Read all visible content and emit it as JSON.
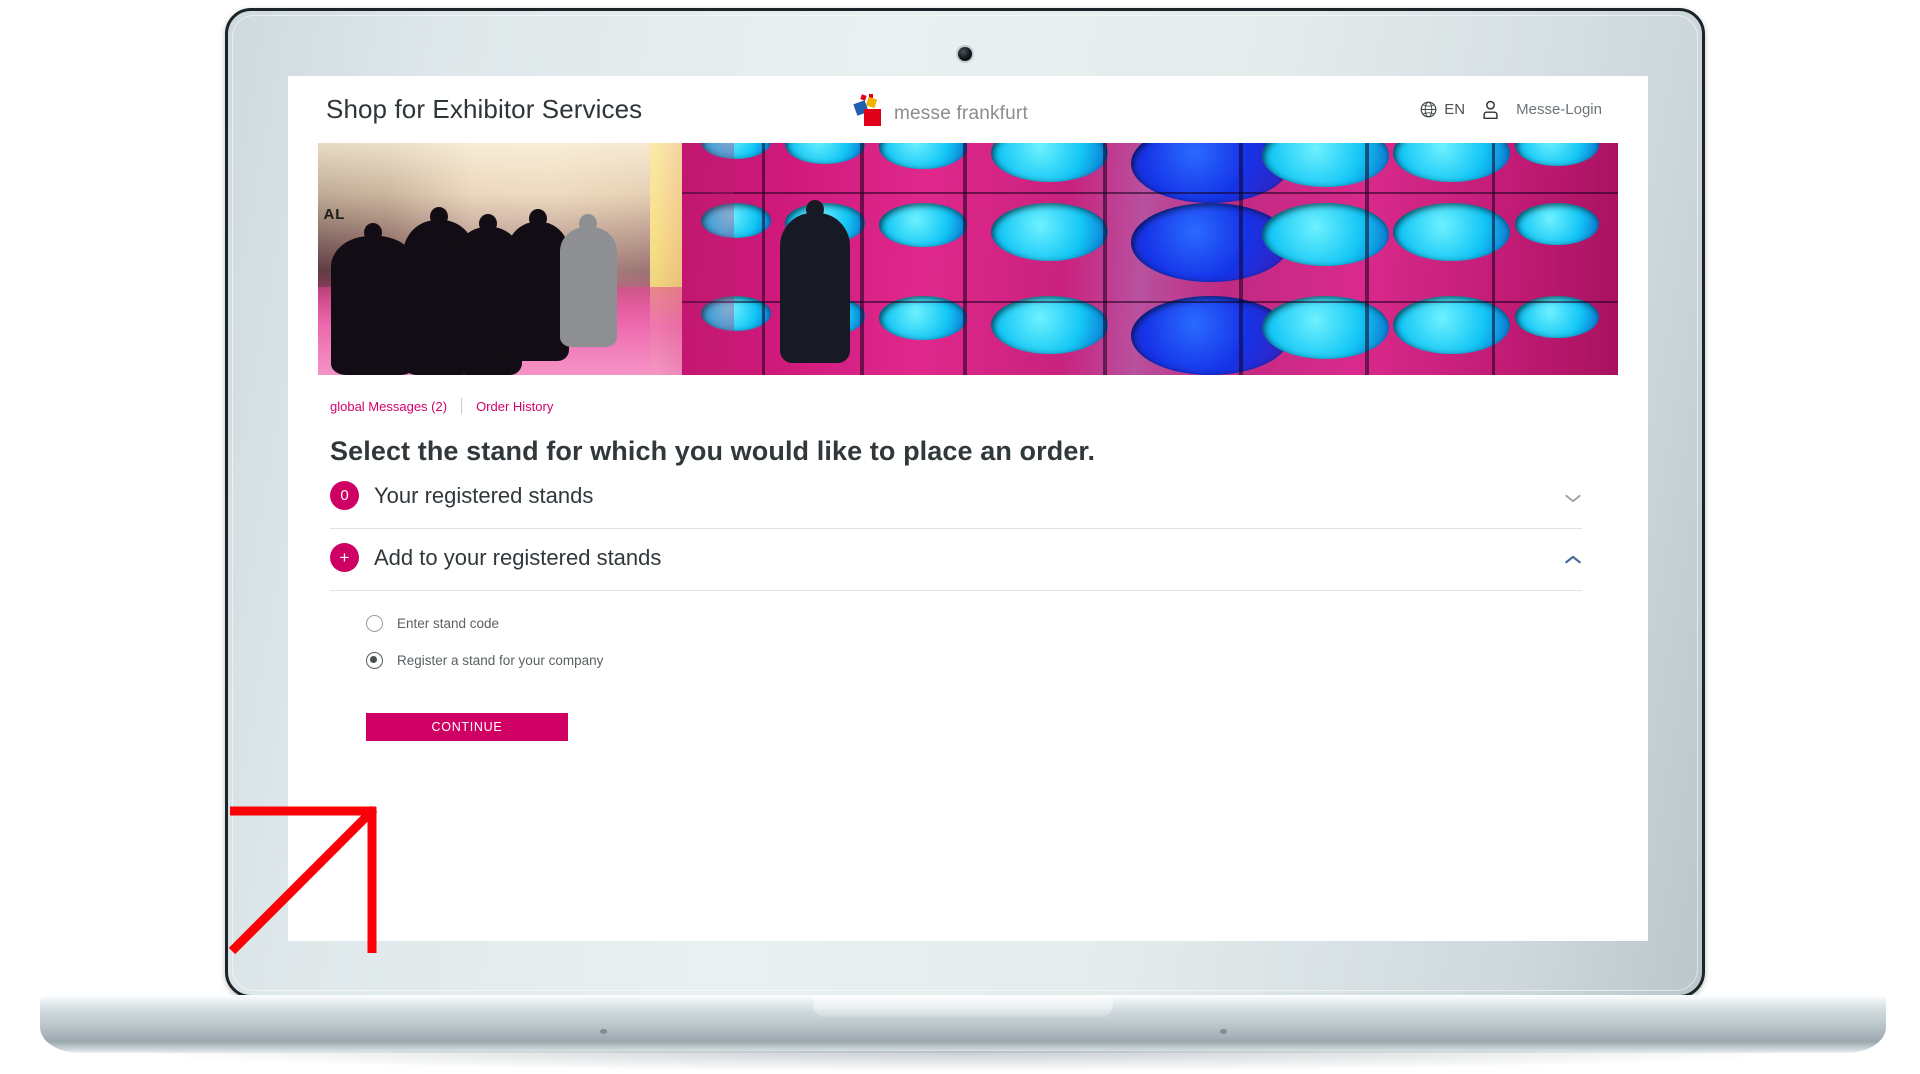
{
  "header": {
    "brand_title": "Shop for Exhibitor Services",
    "logo_text": "messe frankfurt",
    "language_icon": "globe-icon",
    "language_label": "EN",
    "account_icon": "person-icon",
    "login_label": "Messe-Login"
  },
  "banner": {
    "alt_text": "trade fair hall with visitors and magenta porthole wall",
    "sign_text": "AL"
  },
  "quicklinks": {
    "messages_label": "global Messages (2)",
    "order_history_label": "Order History"
  },
  "main": {
    "page_title": "Select the stand for which you would like to place an order.",
    "accordions": [
      {
        "badge": "0",
        "label": "Your registered stands",
        "chevron": "chevron-down-icon",
        "expanded": "false"
      },
      {
        "badge": "+",
        "label": "Add to your registered stands",
        "chevron": "chevron-up-icon",
        "expanded": "true"
      }
    ],
    "radio_options": [
      {
        "label": "Enter stand code",
        "selected": "false"
      },
      {
        "label": "Register a stand for your company",
        "selected": "true"
      }
    ],
    "continue_label": "CONTINUE"
  },
  "colors": {
    "brand_pink": "#cf0063",
    "link_pink": "#d6006c",
    "logo_red": "#e1001a",
    "logo_blue": "#1f5fb0",
    "logo_yellow": "#f4b200",
    "chevron_blue": "#4a6b9a",
    "annotation_red": "#fb0006",
    "text_dark": "#31383b"
  },
  "annotation": {
    "type": "arrow",
    "points_to": "Register a stand for your company radio button"
  }
}
